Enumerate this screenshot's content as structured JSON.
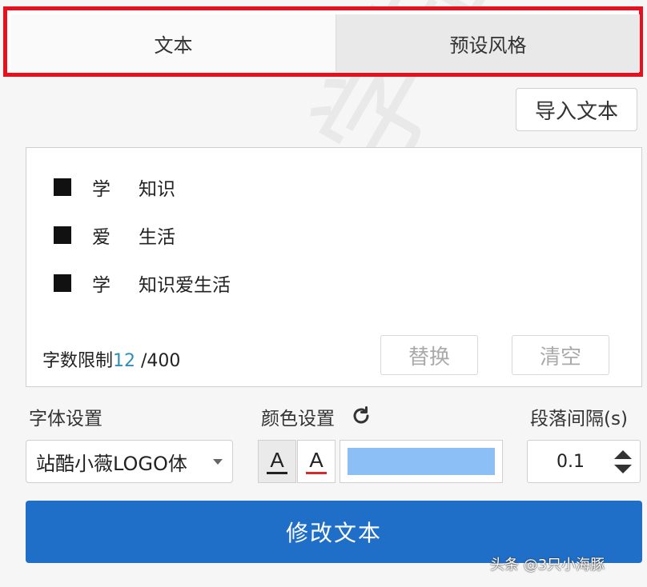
{
  "tabs": [
    {
      "label": "文本",
      "active": true
    },
    {
      "label": "预设风格",
      "active": false
    }
  ],
  "toolbar": {
    "import_label": "导入文本"
  },
  "text_lines": [
    {
      "part1": "学",
      "part2": "知识"
    },
    {
      "part1": "爱",
      "part2": "生活"
    },
    {
      "part1": "学",
      "part2": "知识爱生活"
    }
  ],
  "char_limit": {
    "label": "字数限制",
    "count": "12",
    "max": " /400"
  },
  "actions": {
    "replace_label": "替换",
    "clear_label": "清空"
  },
  "settings": {
    "font_label": "字体设置",
    "color_label": "颜色设置",
    "spacing_label": "段落间隔(s)",
    "font_value": "站酷小薇LOGO体",
    "text_color_glyph": "A",
    "stroke_color_glyph": "A",
    "color_value": "#8dbff7",
    "spacing_value": "0.1"
  },
  "primary_button": {
    "label": "修改文本"
  },
  "watermark": {
    "text": "学知识爱生",
    "credit": "头条 @3只小海豚"
  },
  "colors": {
    "accent": "#1f6fc9",
    "highlight_border": "#e8101c",
    "char_count": "#2d8fb8"
  }
}
